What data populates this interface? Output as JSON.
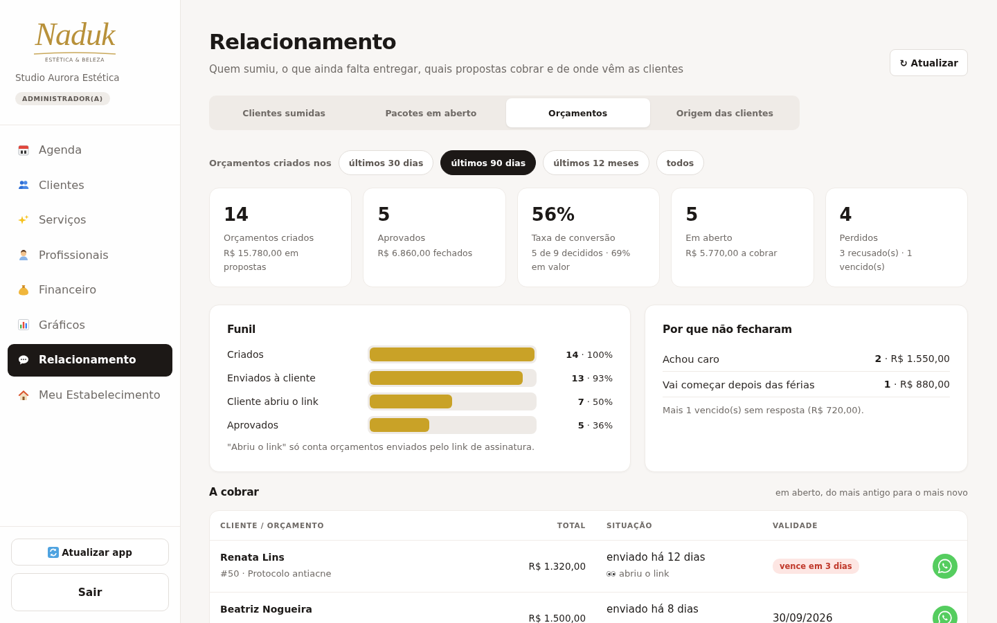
{
  "sidebar": {
    "logo": {
      "wordmark": "Naduk",
      "tagline": "ESTÉTICA & BELEZA"
    },
    "business_name": "Studio Aurora Estética",
    "role_badge": "ADMINISTRADOR(A)",
    "nav_items": [
      {
        "label": "Agenda",
        "selected": false
      },
      {
        "label": "Clientes",
        "selected": false
      },
      {
        "label": "Serviços",
        "selected": false
      },
      {
        "label": "Profissionais",
        "selected": false
      },
      {
        "label": "Financeiro",
        "selected": false
      },
      {
        "label": "Gráficos",
        "selected": false
      },
      {
        "label": "Relacionamento",
        "selected": true
      },
      {
        "label": "Meu Estabelecimento",
        "selected": false
      }
    ],
    "footer_buttons": [
      {
        "label": "Atualizar app",
        "kind": "refresh"
      },
      {
        "label": "Sair",
        "kind": "plain"
      }
    ]
  },
  "header": {
    "title": "Relacionamento",
    "subtitle": "Quem sumiu, o que ainda falta entregar, quais propostas cobrar e de onde vêm as clientes",
    "refresh_button": "↻ Atualizar"
  },
  "tabs": [
    {
      "label": "Clientes sumidas",
      "selected": false
    },
    {
      "label": "Pacotes em aberto",
      "selected": false
    },
    {
      "label": "Orçamentos",
      "selected": true
    },
    {
      "label": "Origem das clientes",
      "selected": false
    }
  ],
  "period_filter": {
    "label": "Orçamentos criados nos",
    "options": [
      {
        "label": "últimos 30 dias",
        "selected": false
      },
      {
        "label": "últimos 90 dias",
        "selected": true
      },
      {
        "label": "últimos 12 meses",
        "selected": false
      },
      {
        "label": "todos",
        "selected": false
      }
    ]
  },
  "kpis": [
    {
      "value": "14",
      "label": "Orçamentos criados",
      "detail": "R$ 15.780,00 em propostas"
    },
    {
      "value": "5",
      "label": "Aprovados",
      "detail": "R$ 6.860,00 fechados"
    },
    {
      "value": "56%",
      "label": "Taxa de conversão",
      "detail": "5 de 9 decididos · 69% em valor"
    },
    {
      "value": "5",
      "label": "Em aberto",
      "detail": "R$ 5.770,00 a cobrar"
    },
    {
      "value": "4",
      "label": "Perdidos",
      "detail": "3 recusado(s) · 1 vencido(s)"
    }
  ],
  "funnel": {
    "title": "Funil",
    "stages": [
      {
        "label": "Criados",
        "level": 1,
        "reading": "**14** · 100%"
      },
      {
        "label": "Enviados à cliente",
        "level": 0.93,
        "reading": "**13** · 93%"
      },
      {
        "label": "Cliente abriu o link",
        "level": 0.5,
        "reading": "**7** · 50%"
      },
      {
        "label": "Aprovados",
        "level": 0.36,
        "reading": "**5** · 36%"
      }
    ],
    "note": "\"Abriu o link\" só conta orçamentos enviados pelo link de assinatura."
  },
  "loss_reasons": {
    "title": "Por que não fecharam",
    "reasons": [
      {
        "label": "Achou caro",
        "reading": "**2** · R$ 1.550,00"
      },
      {
        "label": "Vai começar depois das férias",
        "reading": "**1** · R$ 880,00"
      }
    ],
    "note": "Mais 1 vencido(s) sem resposta (R$ 720,00)."
  },
  "receivables": {
    "title": "A cobrar",
    "caption": "em aberto, do mais antigo para o mais novo",
    "table": {
      "columns": [
        "CLIENTE / ORÇAMENTO",
        "TOTAL",
        "SITUAÇÃO",
        "VALIDADE"
      ],
      "rows": [
        {
          "client": "Renata Lins",
          "quote": "#50 · Protocolo antiacne",
          "total": "R$ 1.320,00",
          "status": "enviado há 12 dias",
          "link_note": "abriu o link",
          "validity": {
            "kind": "badge",
            "text": "vence em 3 dias"
          }
        },
        {
          "client": "Beatriz Nogueira",
          "total": "R$ 1.500,00",
          "status": "enviado há 8 dias",
          "validity": {
            "kind": "date",
            "text": "30/09/2026"
          }
        }
      ]
    }
  }
}
